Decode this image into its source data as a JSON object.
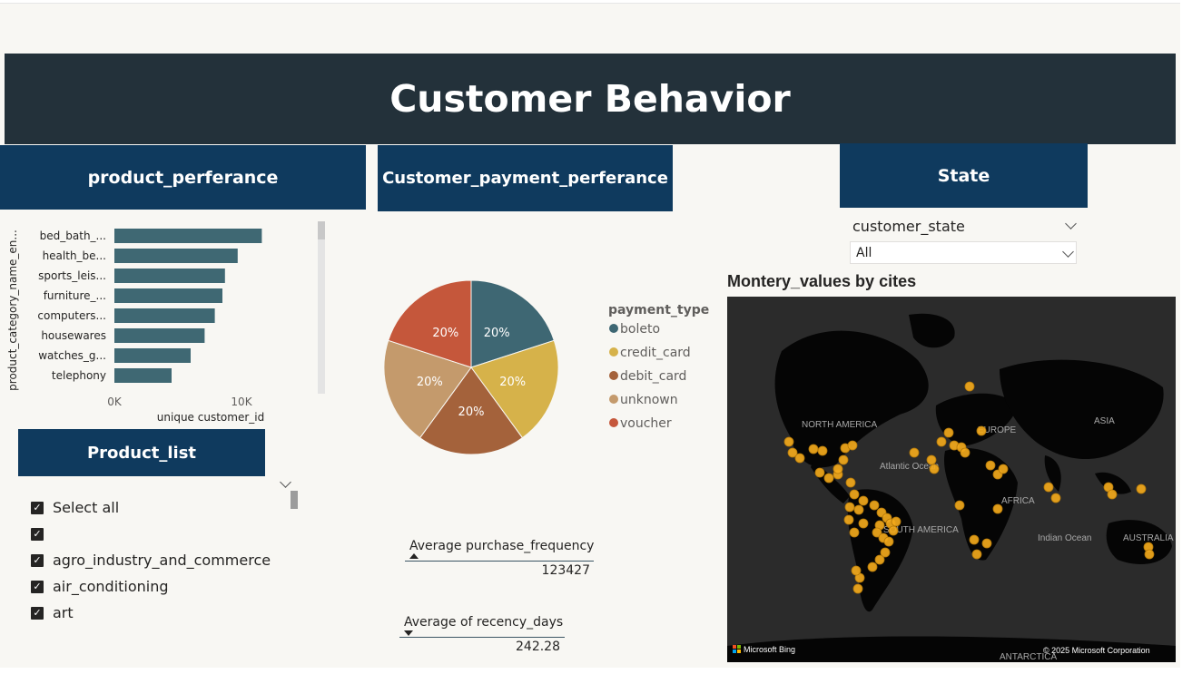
{
  "title": "Customer Behavior",
  "headers": {
    "product": "product_perferance",
    "payment": "Customer_payment_perferance",
    "state": "State",
    "product_list": "Product_list"
  },
  "bar_chart": {
    "type": "bar",
    "orientation": "horizontal",
    "categories": [
      "bed_bath_...",
      "health_be...",
      "sports_leis...",
      "furniture_...",
      "computers...",
      "housewares",
      "watches_g...",
      "telephony"
    ],
    "values": [
      11600,
      9700,
      8700,
      8500,
      7900,
      7100,
      6000,
      4500
    ],
    "xlim": [
      0,
      13000
    ],
    "x_ticks": [
      "0K",
      "10K"
    ],
    "xlabel": "unique customer_id",
    "ylabel": "product_category_name_en...",
    "bar_color": "#3f6873"
  },
  "pie_chart": {
    "type": "pie",
    "legend_title": "payment_type",
    "slices": [
      {
        "name": "boleto",
        "value": 20,
        "label": "20%",
        "color": "#3e6773"
      },
      {
        "name": "credit_card",
        "value": 20,
        "label": "20%",
        "color": "#d6b24a"
      },
      {
        "name": "debit_card",
        "value": 20,
        "label": "20%",
        "color": "#a4623b"
      },
      {
        "name": "unknown",
        "value": 20,
        "label": "20%",
        "color": "#c49a6c"
      },
      {
        "name": "voucher",
        "value": 20,
        "label": "20%",
        "color": "#c5573b"
      }
    ]
  },
  "chart_data": [
    {
      "type": "bar",
      "categories": [
        "bed_bath_...",
        "health_be...",
        "sports_leis...",
        "furniture_...",
        "computers...",
        "housewares",
        "watches_g...",
        "telephony"
      ],
      "values": [
        11600,
        9700,
        8700,
        8500,
        7900,
        7100,
        6000,
        4500
      ],
      "xlabel": "unique customer_id",
      "ylabel": "product_category_name_en...",
      "xlim": [
        0,
        13000
      ]
    },
    {
      "type": "pie",
      "categories": [
        "boleto",
        "credit_card",
        "debit_card",
        "unknown",
        "voucher"
      ],
      "values": [
        20,
        20,
        20,
        20,
        20
      ]
    }
  ],
  "state_slicer": {
    "field": "customer_state",
    "value": "All"
  },
  "map": {
    "title": "Montery_values by cites",
    "labels": [
      "NORTH AMERICA",
      "EUROPE",
      "ASIA",
      "Atlantic Ocean",
      "AFRICA",
      "SOUTH AMERICA",
      "Indian Ocean",
      "AUSTRALIA",
      "ANTARCTICA"
    ],
    "attribution_left": "Microsoft Bing",
    "attribution_right": "© 2025 Microsoft Corporation",
    "point_color": "#f2a91c"
  },
  "product_list": {
    "items": [
      {
        "label": "Select all",
        "checked": true
      },
      {
        "label": "",
        "checked": true
      },
      {
        "label": "agro_industry_and_commerce",
        "checked": true
      },
      {
        "label": "air_conditioning",
        "checked": true
      },
      {
        "label": "art",
        "checked": true
      }
    ]
  },
  "cards": {
    "purchase_freq": {
      "label": "Average purchase_frequency",
      "value": "123427"
    },
    "recency": {
      "label": "Average of recency_days",
      "value": "242.28"
    }
  }
}
